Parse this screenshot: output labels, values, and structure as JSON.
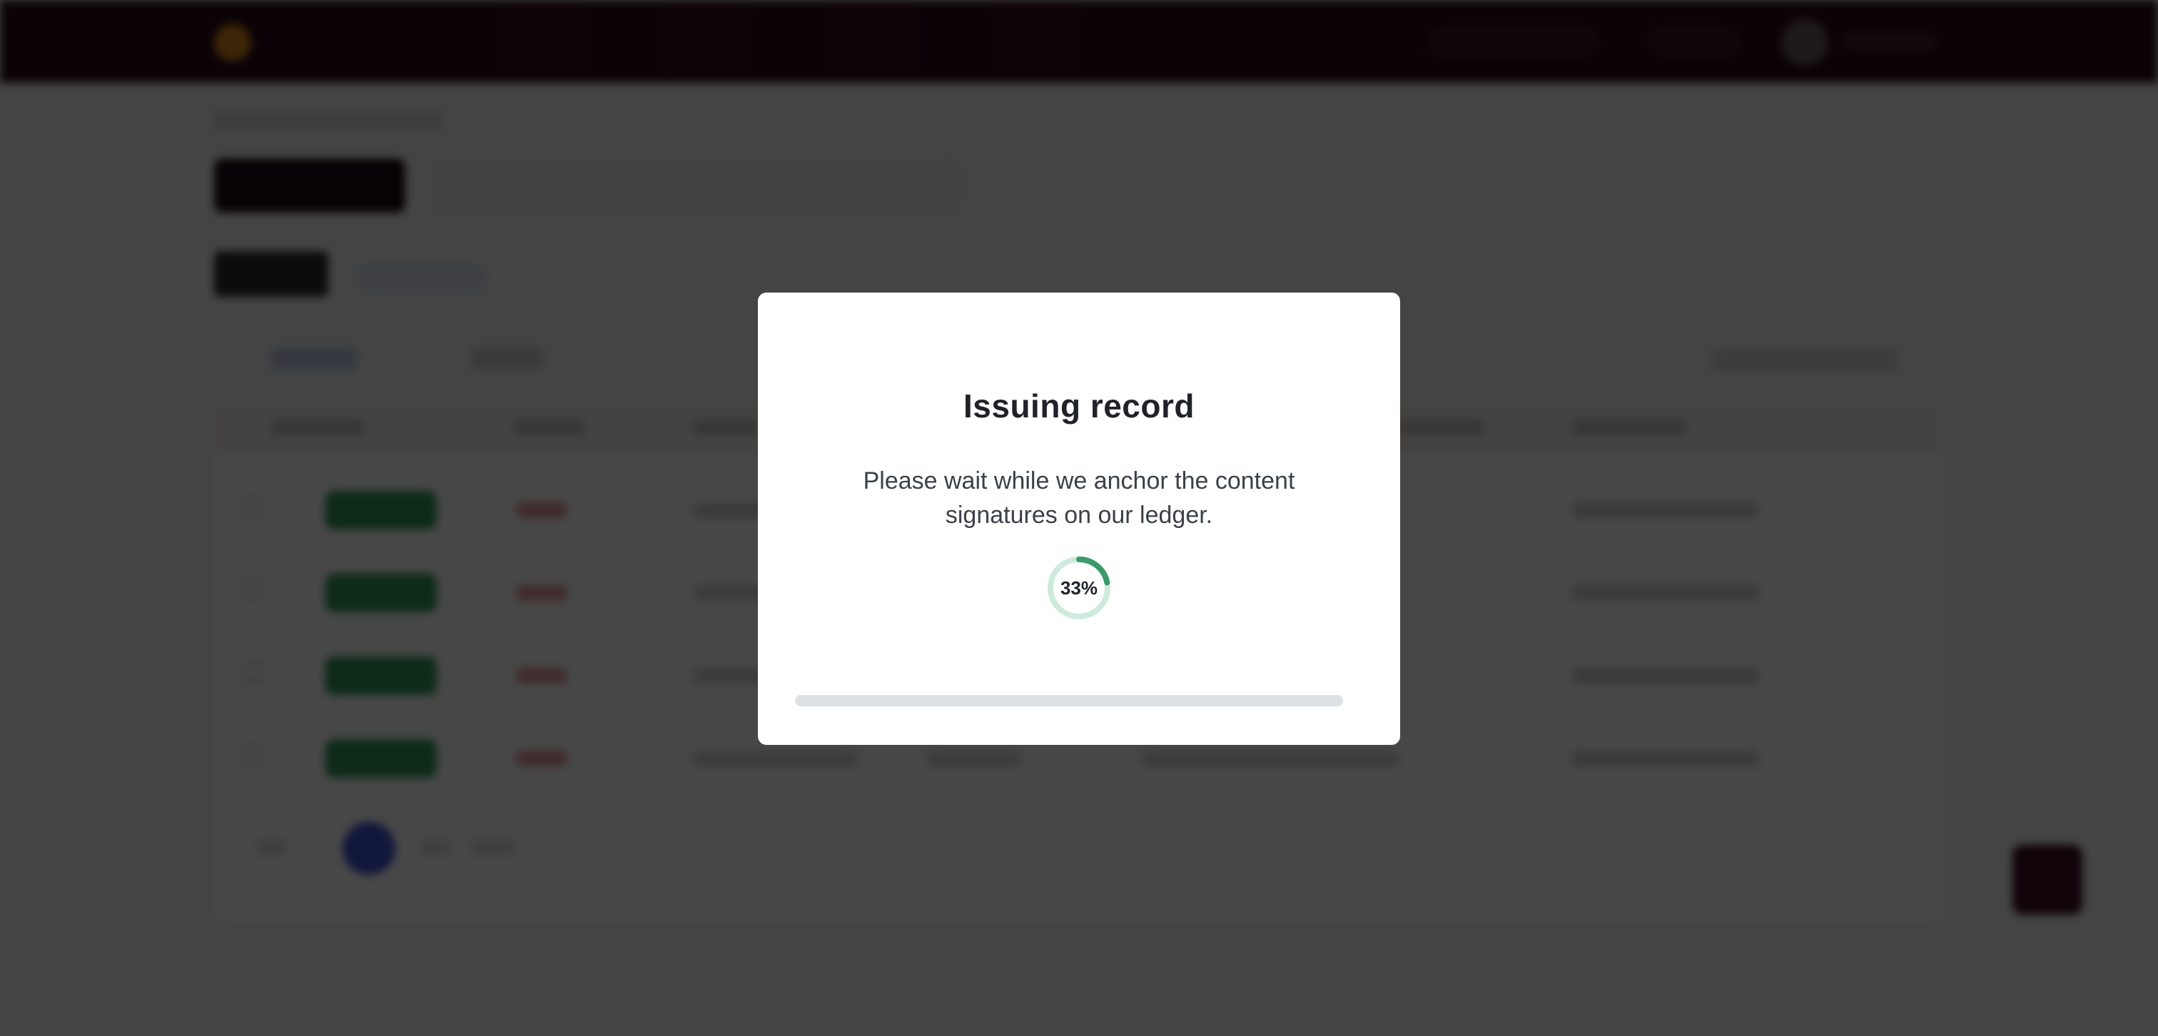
{
  "modal": {
    "title": "Issuing record",
    "description": "Please wait while we anchor the content signatures on our ledger.",
    "progress_label": "33%",
    "progress_fraction": 0.33,
    "progress_color": "#3a9a6a",
    "progress_track_color": "#cdeadd"
  },
  "colors": {
    "overlay": "rgba(0,0,0,0.72)",
    "topbar": "#2a0a1a",
    "status_badge": "#2f9a58",
    "pager_active": "#3f52d6"
  }
}
